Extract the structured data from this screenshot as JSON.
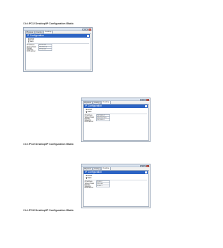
{
  "captions": [
    {
      "prefix": "Click ",
      "bold": "PC1/ Desktop/IP Configuration /Static"
    },
    {
      "prefix": "Click ",
      "bold": "PC2/ Desktop/IP Configuration /Static"
    },
    {
      "prefix": "Click ",
      "bold": "PC3/ Desktop/IP Configuration /Static"
    }
  ],
  "windows": [
    {
      "tabs": [
        "Physical",
        "Config",
        "Desktop"
      ],
      "active_tab": "Desktop",
      "panel_title": "IP Configuration",
      "close_label": "X",
      "modes": [
        "DHCP",
        "Static"
      ],
      "selected_mode": "Static",
      "fields": [
        {
          "label": "IP Address",
          "value": "172.16.0.2"
        },
        {
          "label": "Subnet Mask",
          "value": "255.255.0.0"
        },
        {
          "label": "Default Gateway",
          "value": "172.16.0.1"
        },
        {
          "label": "DNS Server",
          "value": ""
        }
      ]
    },
    {
      "tabs": [
        "Physical",
        "Config",
        "Desktop"
      ],
      "active_tab": "Desktop",
      "panel_title": "IP Configuration",
      "close_label": "X",
      "modes": [
        "DHCP",
        "Static"
      ],
      "selected_mode": "Static",
      "fields": [
        {
          "label": "IP Address",
          "value": "192.168.0.2"
        },
        {
          "label": "Subnet Mask",
          "value": "255.255.255.0"
        },
        {
          "label": "Default Gateway",
          "value": "192.168.0.1"
        },
        {
          "label": "DNS Server",
          "value": ""
        }
      ]
    },
    {
      "tabs": [
        "Physical",
        "Config",
        "Desktop"
      ],
      "active_tab": "Desktop",
      "panel_title": "IP Configuration",
      "close_label": "X",
      "modes": [
        "DHCP",
        "Static"
      ],
      "selected_mode": "Static",
      "fields": [
        {
          "label": "IP Address",
          "value": "10.0.0.2"
        },
        {
          "label": "Subnet Mask",
          "value": "255.0.0.0"
        },
        {
          "label": "Default Gateway",
          "value": "10.0.0.1"
        },
        {
          "label": "DNS Server",
          "value": ""
        }
      ]
    }
  ]
}
